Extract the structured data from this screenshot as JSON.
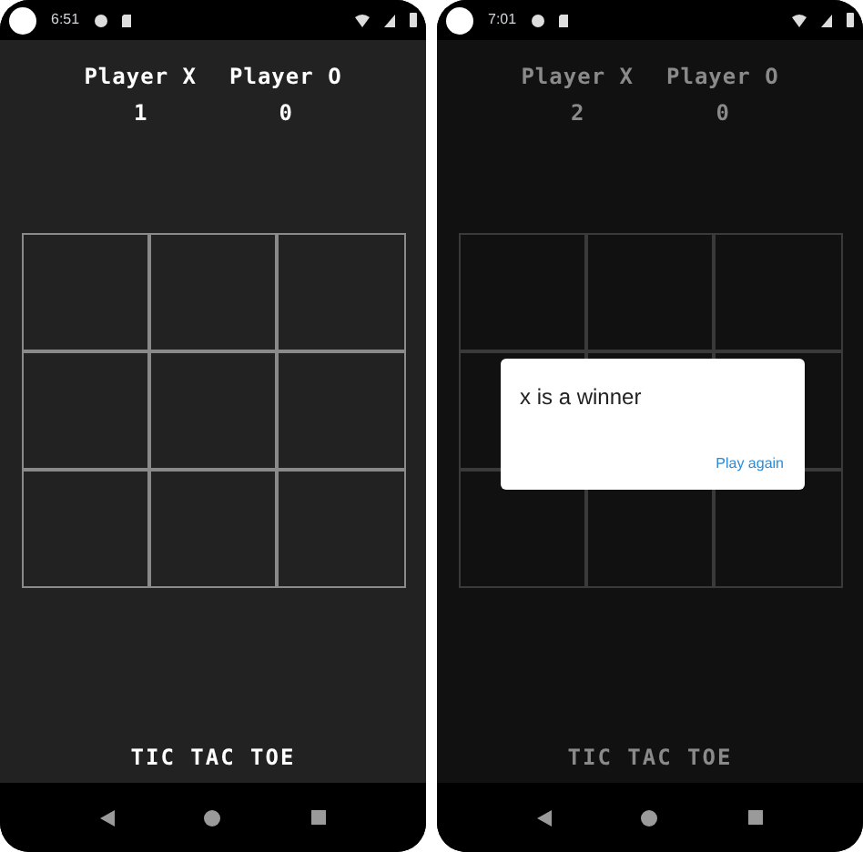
{
  "screens": [
    {
      "status_time": "6:51",
      "players": [
        {
          "name": "Player X",
          "score": "1"
        },
        {
          "name": "Player O",
          "score": "0"
        }
      ],
      "title": "TIC TAC TOE"
    },
    {
      "status_time": "7:01",
      "players": [
        {
          "name": "Player X",
          "score": "2"
        },
        {
          "name": "Player O",
          "score": "0"
        }
      ],
      "title": "TIC TAC TOE",
      "dialog": {
        "message": "x is a winner",
        "button": "Play again"
      }
    }
  ]
}
